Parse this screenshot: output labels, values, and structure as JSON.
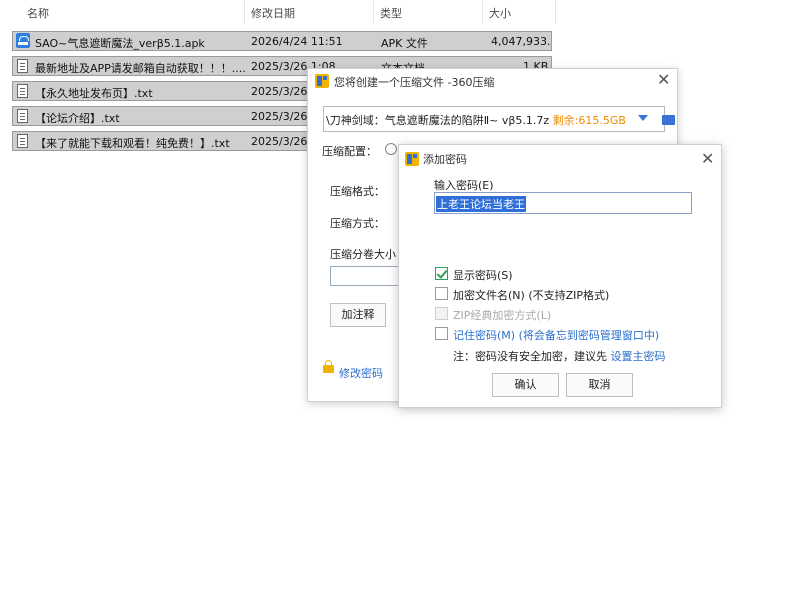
{
  "file_list": {
    "columns": [
      "名称",
      "修改日期",
      "类型",
      "大小"
    ],
    "rows": [
      {
        "name": "SAO~气息遮断魔法_verβ5.1.apk",
        "date": "2026/4/24 11:51",
        "type": "APK 文件",
        "size": "4,047,933...",
        "icon": "apk-icon"
      },
      {
        "name": "最新地址及APP请发邮箱自动获取！！！....",
        "date": "2025/3/26 1:08",
        "type": "文本文档",
        "size": "1 KB",
        "icon": "text-file-icon"
      },
      {
        "name": "【永久地址发布页】.txt",
        "date": "2025/3/26",
        "type": "",
        "size": "",
        "icon": "text-file-icon"
      },
      {
        "name": "【论坛介绍】.txt",
        "date": "2025/3/26",
        "type": "",
        "size": "",
        "icon": "text-file-icon"
      },
      {
        "name": "【来了就能下载和观看！纯免费！】.txt",
        "date": "2025/3/26",
        "type": "",
        "size": "",
        "icon": "text-file-icon"
      }
    ]
  },
  "compress_dialog": {
    "title": "您将创建一个压缩文件 -360压缩",
    "path": "\\刀神剑域：气息遮断魔法的陷阱Ⅱ~ vβ5.1.7z",
    "free_space": "剩余:615.5GB",
    "config_label": "压缩配置：",
    "format_label": "压缩格式：",
    "method_label": "压缩方式：",
    "split_label": "压缩分卷大小：",
    "comment_button": "加注释",
    "change_password_link": "修改密码"
  },
  "password_dialog": {
    "title": "添加密码",
    "input_label": "输入密码(E)",
    "password_value": "上老王论坛当老王",
    "show_password": "显示密码(S)",
    "encrypt_filenames": "加密文件名(N)",
    "encrypt_filenames_note": "(不支持ZIP格式)",
    "zip_classic": "ZIP经典加密方式(L)",
    "remember_password": "记住密码(M)",
    "remember_note": "(将会备忘到密码管理窗口中)",
    "note_prefix": "注：密码没有安全加密，建议先",
    "note_link": "设置主密码",
    "ok_button": "确认",
    "cancel_button": "取消",
    "checks": {
      "show_password": true,
      "encrypt_filenames": false,
      "zip_classic": false,
      "remember_password": false
    }
  },
  "colors": {
    "accent": "#2a6fcf",
    "free_space": "#f08a00",
    "check": "#2aa05a",
    "selection": "#2f6fd6"
  }
}
